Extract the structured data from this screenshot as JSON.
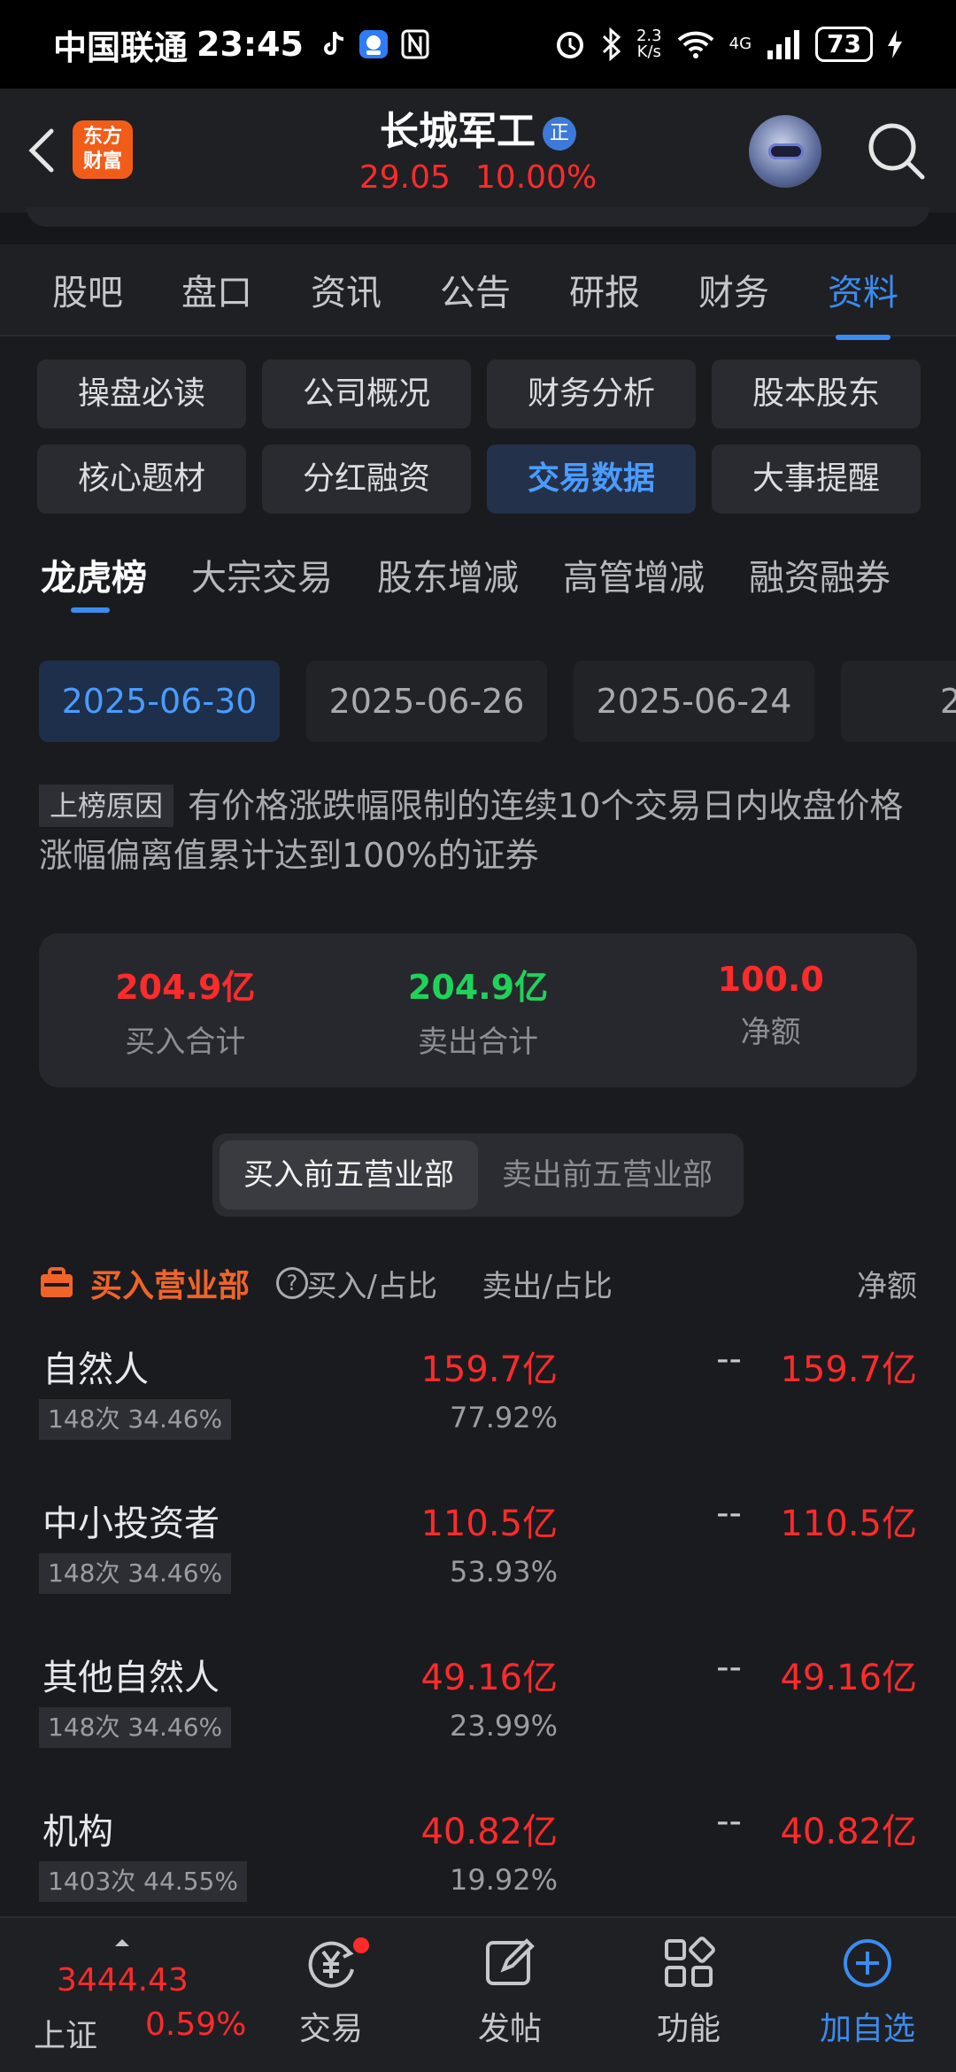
{
  "status_bar": {
    "carrier": "中国联通",
    "time": "23:45",
    "net_speed_top": "2.3",
    "net_speed_bottom": "K/s",
    "network": "4G",
    "battery": "73"
  },
  "header": {
    "logo_line1": "东方",
    "logo_line2": "财富",
    "title": "长城军工",
    "title_badge": "正",
    "price": "29.05",
    "change_pct": "10.00%"
  },
  "main_tabs": [
    {
      "label": "股吧"
    },
    {
      "label": "盘口"
    },
    {
      "label": "资讯"
    },
    {
      "label": "公告"
    },
    {
      "label": "研报"
    },
    {
      "label": "财务"
    },
    {
      "label": "资料",
      "active": true
    }
  ],
  "grid_buttons": [
    {
      "label": "操盘必读"
    },
    {
      "label": "公司概况"
    },
    {
      "label": "财务分析"
    },
    {
      "label": "股本股东"
    },
    {
      "label": "核心题材"
    },
    {
      "label": "分红融资"
    },
    {
      "label": "交易数据",
      "active": true
    },
    {
      "label": "大事提醒"
    }
  ],
  "sub_tabs": [
    {
      "label": "龙虎榜",
      "active": true
    },
    {
      "label": "大宗交易"
    },
    {
      "label": "股东增减"
    },
    {
      "label": "高管增减"
    },
    {
      "label": "融资融券"
    }
  ],
  "dates": [
    {
      "label": "2025-06-30",
      "active": true
    },
    {
      "label": "2025-06-26"
    },
    {
      "label": "2025-06-24"
    },
    {
      "label": "20"
    }
  ],
  "reason": {
    "tag": "上榜原因",
    "text": "有价格涨跌幅限制的连续10个交易日内收盘价格涨幅偏离值累计达到100%的证券"
  },
  "summary": {
    "buy_total": "204.9亿",
    "buy_label": "买入合计",
    "sell_total": "204.9亿",
    "sell_label": "卖出合计",
    "net": "100.0",
    "net_label": "净额"
  },
  "toggle": {
    "buy_top5": "买入前五营业部",
    "sell_top5": "卖出前五营业部"
  },
  "table": {
    "title": "买入营业部",
    "help": "?",
    "col_buy": "买入/占比",
    "col_sell": "卖出/占比",
    "col_net": "净额",
    "rows": [
      {
        "name": "自然人",
        "meta": "148次 34.46%",
        "buy": "159.7亿",
        "buy_pct": "77.92%",
        "sell": "--",
        "net": "159.7亿"
      },
      {
        "name": "中小投资者",
        "meta": "148次 34.46%",
        "buy": "110.5亿",
        "buy_pct": "53.93%",
        "sell": "--",
        "net": "110.5亿"
      },
      {
        "name": "其他自然人",
        "meta": "148次 34.46%",
        "buy": "49.16亿",
        "buy_pct": "23.99%",
        "sell": "--",
        "net": "49.16亿"
      },
      {
        "name": "机构",
        "meta": "1403次 44.55%",
        "buy": "40.82亿",
        "buy_pct": "19.92%",
        "sell": "--",
        "net": "40.82亿"
      }
    ]
  },
  "bottom_nav": {
    "index_value": "3444.43",
    "index_name": "上证",
    "index_change": "0.59%",
    "trade": "交易",
    "post": "发帖",
    "functions": "功能",
    "add_watch": "加自选"
  },
  "colors": {
    "up_red": "#ff2b2b",
    "down_green": "#1fd35a",
    "accent_blue": "#3b8cf0",
    "brand_orange": "#f25c19"
  },
  "icons": [
    "back-arrow-icon",
    "verified-badge-icon",
    "robot-assistant-icon",
    "search-icon",
    "shopping-bag-icon",
    "help-icon",
    "trade-icon",
    "edit-icon",
    "grid-icon",
    "add-circle-icon"
  ]
}
